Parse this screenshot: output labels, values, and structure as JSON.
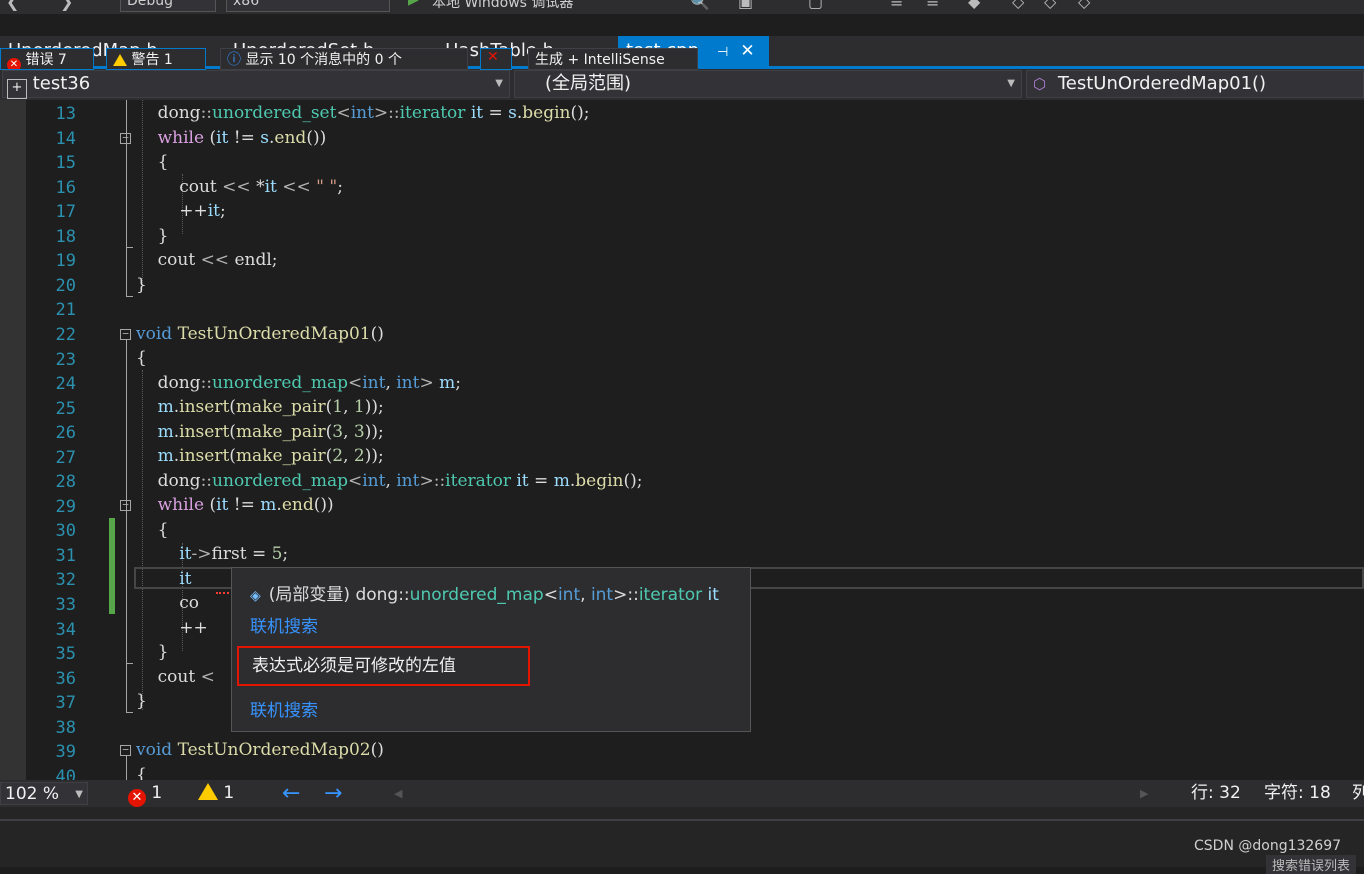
{
  "toolbar": {
    "config": "Debug",
    "platform": "x86",
    "run_label": "本地 Windows 调试器"
  },
  "tabs": [
    {
      "label": "UnorderedMap.h"
    },
    {
      "label": "UnorderedSet.h"
    },
    {
      "label": "HashTable.h"
    },
    {
      "label": "test.cpp",
      "active": true
    }
  ],
  "nav": {
    "project": "test36",
    "scope": "(全局范围)",
    "function": "TestUnOrderedMap01()"
  },
  "editor": {
    "line_numbers": [
      "13",
      "14",
      "15",
      "16",
      "17",
      "18",
      "19",
      "20",
      "21",
      "22",
      "23",
      "24",
      "25",
      "26",
      "27",
      "28",
      "29",
      "30",
      "31",
      "32",
      "33",
      "34",
      "35",
      "36",
      "37",
      "38",
      "39",
      "40"
    ],
    "current_line": 32
  },
  "tooltip": {
    "signature_prefix": "(局部变量) dong::",
    "signature_type": "unordered_map",
    "signature_rest1": "<",
    "signature_int1": "int",
    "signature_comma": ", ",
    "signature_int2": "int",
    "signature_rest2": ">::",
    "signature_iter": "iterator",
    "signature_var": " it",
    "link1": "联机搜索",
    "error_message": "表达式必须是可修改的左值",
    "link2": "联机搜索"
  },
  "status": {
    "zoom": "102 %",
    "errors": "1",
    "warnings": "1",
    "line_label": "行: 32",
    "char_label": "字符: 18",
    "col_label": "列"
  },
  "panel": {
    "errors_tab": "错误 7",
    "warnings_tab": "警告 1",
    "messages_tab": "显示 10 个消息中的 0 个",
    "build_tab": "生成 + IntelliSense",
    "search_errors": "搜索错误列表"
  },
  "watermark": "CSDN @dong132697",
  "colors": {
    "accent": "#007acc",
    "error_border": "#e51400",
    "link": "#3794ff",
    "change_bar": "#57a64a"
  }
}
